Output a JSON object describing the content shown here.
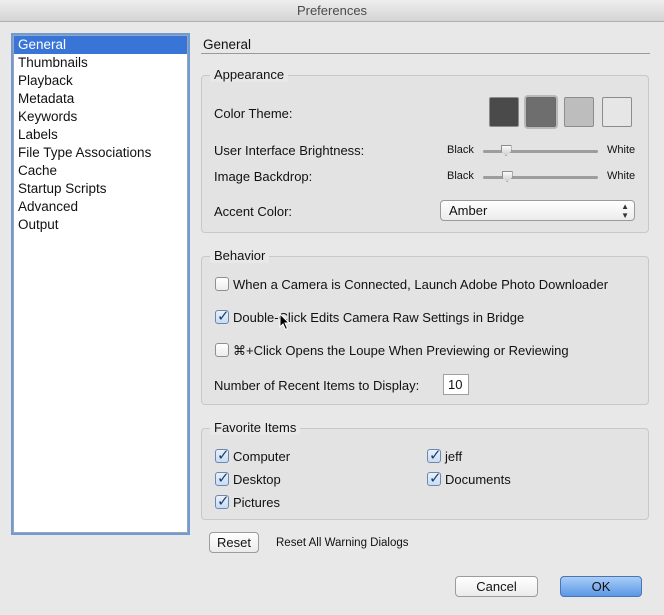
{
  "window": {
    "title": "Preferences"
  },
  "sidebar": {
    "items": [
      {
        "label": "General",
        "selected": true
      },
      {
        "label": "Thumbnails"
      },
      {
        "label": "Playback"
      },
      {
        "label": "Metadata"
      },
      {
        "label": "Keywords"
      },
      {
        "label": "Labels"
      },
      {
        "label": "File Type Associations"
      },
      {
        "label": "Cache"
      },
      {
        "label": "Startup Scripts"
      },
      {
        "label": "Advanced"
      },
      {
        "label": "Output"
      }
    ]
  },
  "main": {
    "title": "General",
    "appearance": {
      "label": "Appearance",
      "color_theme_label": "Color Theme:",
      "themes": [
        {
          "color": "#4a4a4a"
        },
        {
          "color": "#6e6e6e",
          "selected": true
        },
        {
          "color": "#bdbdbd"
        },
        {
          "color": "#e6e6e6"
        }
      ],
      "brightness_label": "User Interface Brightness:",
      "brightness_min": "Black",
      "brightness_max": "White",
      "brightness_value": 0.2,
      "backdrop_label": "Image Backdrop:",
      "backdrop_min": "Black",
      "backdrop_max": "White",
      "backdrop_value": 0.21,
      "accent_label": "Accent Color:",
      "accent_value": "Amber"
    },
    "behavior": {
      "label": "Behavior",
      "options": [
        {
          "label": "When a Camera is Connected, Launch Adobe Photo Downloader",
          "checked": false
        },
        {
          "label": "Double-Click Edits Camera Raw Settings in Bridge",
          "checked": true
        },
        {
          "label": "⌘+Click Opens the Loupe When Previewing or Reviewing",
          "checked": false
        }
      ],
      "recent_label": "Number of Recent Items to Display:",
      "recent_value": "10"
    },
    "favorites": {
      "label": "Favorite Items",
      "items": [
        {
          "label": "Computer",
          "checked": true
        },
        {
          "label": "Desktop",
          "checked": true
        },
        {
          "label": "Pictures",
          "checked": true
        },
        {
          "label": "jeff",
          "checked": true
        },
        {
          "label": "Documents",
          "checked": true
        }
      ]
    },
    "reset_button": "Reset",
    "reset_label": "Reset All Warning Dialogs"
  },
  "footer": {
    "cancel": "Cancel",
    "ok": "OK"
  },
  "colors": {
    "selection": "#3875d7",
    "primary_button": "#5b98e6"
  }
}
